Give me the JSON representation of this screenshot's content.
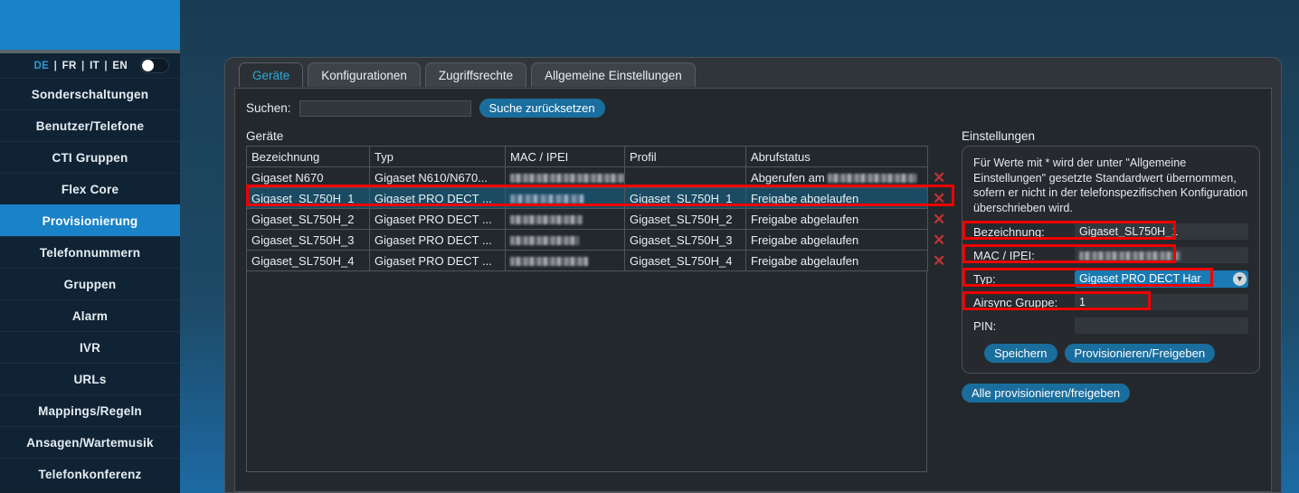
{
  "sidebar": {
    "languages": [
      "DE",
      "FR",
      "IT",
      "EN"
    ],
    "active_language": "DE",
    "items": [
      {
        "label": "Sonderschaltungen",
        "active": false
      },
      {
        "label": "Benutzer/Telefone",
        "active": false
      },
      {
        "label": "CTI Gruppen",
        "active": false
      },
      {
        "label": "Flex Core",
        "active": false
      },
      {
        "label": "Provisionierung",
        "active": true
      },
      {
        "label": "Telefonnummern",
        "active": false
      },
      {
        "label": "Gruppen",
        "active": false
      },
      {
        "label": "Alarm",
        "active": false
      },
      {
        "label": "IVR",
        "active": false
      },
      {
        "label": "URLs",
        "active": false
      },
      {
        "label": "Mappings/Regeln",
        "active": false
      },
      {
        "label": "Ansagen/Wartemusik",
        "active": false
      },
      {
        "label": "Telefonkonferenz",
        "active": false
      }
    ]
  },
  "tabs": [
    {
      "label": "Geräte",
      "active": true
    },
    {
      "label": "Konfigurationen",
      "active": false
    },
    {
      "label": "Zugriffsrechte",
      "active": false
    },
    {
      "label": "Allgemeine Einstellungen",
      "active": false
    }
  ],
  "search": {
    "label": "Suchen:",
    "value": "",
    "placeholder": "",
    "reset_button": "Suche zurücksetzen"
  },
  "devices": {
    "title": "Geräte",
    "columns": [
      "Bezeichnung",
      "Typ",
      "MAC / IPEI",
      "Profil",
      "Abrufstatus"
    ],
    "rows": [
      {
        "bezeichnung": "Gigaset  N670",
        "typ": "Gigaset N610/N670...",
        "mac_redacted": true,
        "mac_width": 140,
        "profil": "",
        "abrufstatus": "Abgerufen am ",
        "abruf_redacted": true,
        "abruf_width": 98,
        "selected": false
      },
      {
        "bezeichnung": "Gigaset_SL750H_1",
        "typ": "Gigaset PRO DECT ...",
        "mac_redacted": true,
        "mac_width": 82,
        "profil": "Gigaset_SL750H_1",
        "abrufstatus": "Freigabe abgelaufen",
        "abruf_redacted": false,
        "abruf_width": 0,
        "selected": true
      },
      {
        "bezeichnung": "Gigaset_SL750H_2",
        "typ": "Gigaset PRO DECT ...",
        "mac_redacted": true,
        "mac_width": 80,
        "profil": "Gigaset_SL750H_2",
        "abrufstatus": "Freigabe abgelaufen",
        "abruf_redacted": false,
        "abruf_width": 0,
        "selected": false
      },
      {
        "bezeichnung": "Gigaset_SL750H_3",
        "typ": "Gigaset PRO DECT ...",
        "mac_redacted": true,
        "mac_width": 76,
        "profil": "Gigaset_SL750H_3",
        "abrufstatus": "Freigabe abgelaufen",
        "abruf_redacted": false,
        "abruf_width": 0,
        "selected": false
      },
      {
        "bezeichnung": "Gigaset_SL750H_4",
        "typ": "Gigaset PRO DECT ...",
        "mac_redacted": true,
        "mac_width": 86,
        "profil": "Gigaset_SL750H_4",
        "abrufstatus": "Freigabe abgelaufen",
        "abruf_redacted": false,
        "abruf_width": 0,
        "selected": false
      }
    ],
    "delete_icon": "✕"
  },
  "settings": {
    "title": "Einstellungen",
    "note": "Für Werte mit * wird der unter \"Allgemeine Einstellungen\" gesetzte Standardwert übernommen, sofern er nicht in der telefonspezifischen Konfiguration überschrieben wird.",
    "fields": [
      {
        "label": "Bezeichnung:",
        "value": "Gigaset_SL750H_1",
        "type": "text",
        "redacted": false
      },
      {
        "label": "MAC / IPEI:",
        "value": "",
        "type": "text",
        "redacted": true
      },
      {
        "label": "Typ:",
        "value": "Gigaset PRO DECT Har",
        "type": "select",
        "redacted": false
      },
      {
        "label": "Airsync Gruppe:",
        "value": "1",
        "type": "text",
        "redacted": false
      },
      {
        "label": "PIN:",
        "value": "",
        "type": "text",
        "redacted": false
      }
    ],
    "save_button": "Speichern",
    "provision_button": "Provisionieren/Freigeben",
    "provision_all_button": "Alle provisionieren/freigeben",
    "chevron_icon": "▼"
  },
  "colors": {
    "accent_blue": "#1a83c8",
    "button_blue": "#1a6e9e",
    "tab_active_text": "#2fa8da",
    "selected_row": "#1a4b63",
    "highlight_red": "#f00000",
    "delete_x": "#bb3434"
  }
}
